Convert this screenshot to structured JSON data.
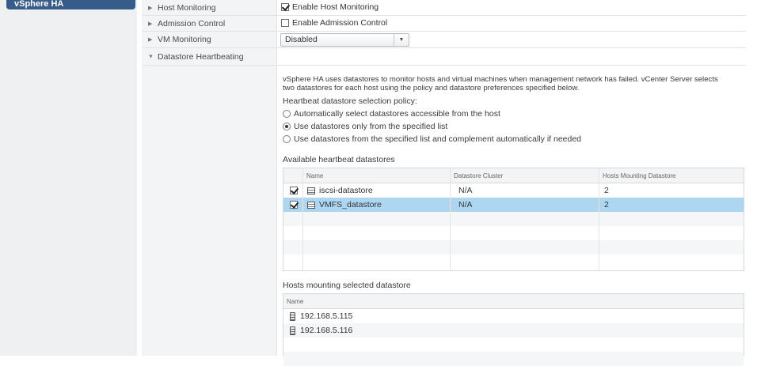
{
  "sidebar": {
    "selected": "vSphere HA"
  },
  "settings": {
    "host_monitoring": {
      "label": "Host Monitoring",
      "checkbox_label": "Enable Host Monitoring",
      "checked": true
    },
    "admission_control": {
      "label": "Admission Control",
      "checkbox_label": "Enable Admission Control",
      "checked": false
    },
    "vm_monitoring": {
      "label": "VM Monitoring",
      "value": "Disabled"
    },
    "datastore_heartbeating": {
      "label": "Datastore Heartbeating"
    }
  },
  "heartbeat": {
    "description_line1": "vSphere HA uses datastores to monitor hosts and virtual machines when management network has failed. vCenter Server selects",
    "description_line2": "two datastores for each host using the policy and datastore preferences specified below.",
    "policy_label": "Heartbeat datastore selection policy:",
    "options": [
      {
        "label": "Automatically select datastores accessible from the host",
        "selected": false
      },
      {
        "label": "Use datastores only from the specified list",
        "selected": true
      },
      {
        "label": "Use datastores from the specified list and complement automatically if needed",
        "selected": false
      }
    ],
    "available_label": "Available heartbeat datastores",
    "columns": [
      "Name",
      "Datastore Cluster",
      "Hosts Mounting Datastore"
    ],
    "datastores": [
      {
        "name": "iscsi-datastore",
        "cluster": "N/A",
        "hosts": "2",
        "checked": true,
        "selected": false
      },
      {
        "name": "VMFS_datastore",
        "cluster": "N/A",
        "hosts": "2",
        "checked": true,
        "selected": true
      }
    ]
  },
  "hosts_mounting": {
    "label": "Hosts mounting selected datastore",
    "column": "Name",
    "hosts": [
      "192.168.5.115",
      "192.168.5.116"
    ]
  }
}
